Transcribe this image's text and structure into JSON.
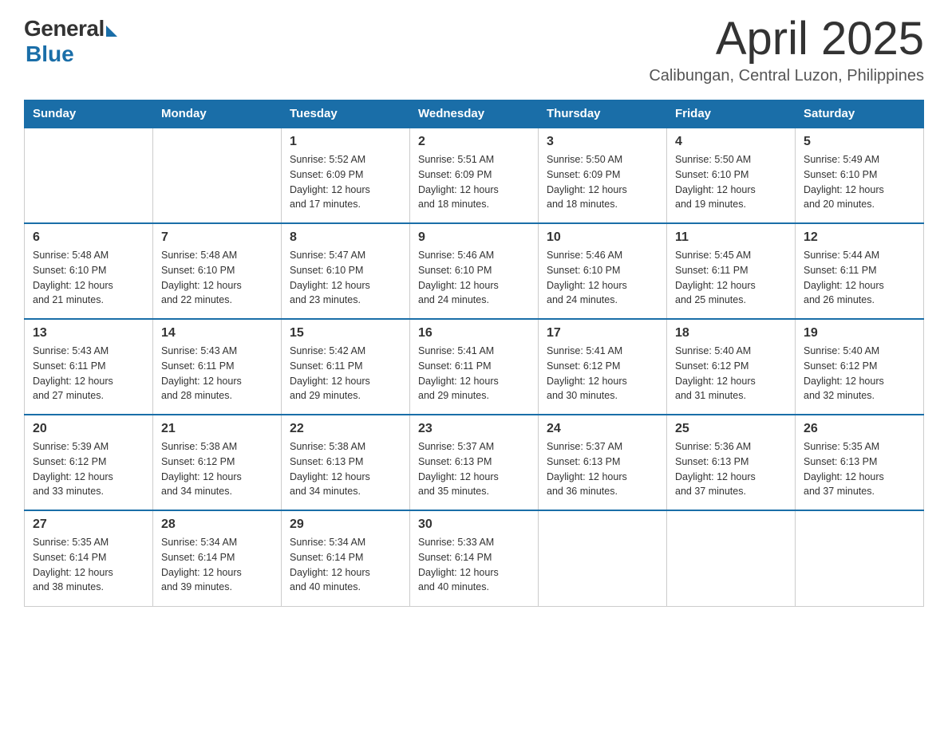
{
  "logo": {
    "general": "General",
    "blue": "Blue",
    "underline": "Blue"
  },
  "title": {
    "month_year": "April 2025",
    "location": "Calibungan, Central Luzon, Philippines"
  },
  "days_of_week": [
    "Sunday",
    "Monday",
    "Tuesday",
    "Wednesday",
    "Thursday",
    "Friday",
    "Saturday"
  ],
  "weeks": [
    [
      {
        "day": "",
        "info": ""
      },
      {
        "day": "",
        "info": ""
      },
      {
        "day": "1",
        "info": "Sunrise: 5:52 AM\nSunset: 6:09 PM\nDaylight: 12 hours\nand 17 minutes."
      },
      {
        "day": "2",
        "info": "Sunrise: 5:51 AM\nSunset: 6:09 PM\nDaylight: 12 hours\nand 18 minutes."
      },
      {
        "day": "3",
        "info": "Sunrise: 5:50 AM\nSunset: 6:09 PM\nDaylight: 12 hours\nand 18 minutes."
      },
      {
        "day": "4",
        "info": "Sunrise: 5:50 AM\nSunset: 6:10 PM\nDaylight: 12 hours\nand 19 minutes."
      },
      {
        "day": "5",
        "info": "Sunrise: 5:49 AM\nSunset: 6:10 PM\nDaylight: 12 hours\nand 20 minutes."
      }
    ],
    [
      {
        "day": "6",
        "info": "Sunrise: 5:48 AM\nSunset: 6:10 PM\nDaylight: 12 hours\nand 21 minutes."
      },
      {
        "day": "7",
        "info": "Sunrise: 5:48 AM\nSunset: 6:10 PM\nDaylight: 12 hours\nand 22 minutes."
      },
      {
        "day": "8",
        "info": "Sunrise: 5:47 AM\nSunset: 6:10 PM\nDaylight: 12 hours\nand 23 minutes."
      },
      {
        "day": "9",
        "info": "Sunrise: 5:46 AM\nSunset: 6:10 PM\nDaylight: 12 hours\nand 24 minutes."
      },
      {
        "day": "10",
        "info": "Sunrise: 5:46 AM\nSunset: 6:10 PM\nDaylight: 12 hours\nand 24 minutes."
      },
      {
        "day": "11",
        "info": "Sunrise: 5:45 AM\nSunset: 6:11 PM\nDaylight: 12 hours\nand 25 minutes."
      },
      {
        "day": "12",
        "info": "Sunrise: 5:44 AM\nSunset: 6:11 PM\nDaylight: 12 hours\nand 26 minutes."
      }
    ],
    [
      {
        "day": "13",
        "info": "Sunrise: 5:43 AM\nSunset: 6:11 PM\nDaylight: 12 hours\nand 27 minutes."
      },
      {
        "day": "14",
        "info": "Sunrise: 5:43 AM\nSunset: 6:11 PM\nDaylight: 12 hours\nand 28 minutes."
      },
      {
        "day": "15",
        "info": "Sunrise: 5:42 AM\nSunset: 6:11 PM\nDaylight: 12 hours\nand 29 minutes."
      },
      {
        "day": "16",
        "info": "Sunrise: 5:41 AM\nSunset: 6:11 PM\nDaylight: 12 hours\nand 29 minutes."
      },
      {
        "day": "17",
        "info": "Sunrise: 5:41 AM\nSunset: 6:12 PM\nDaylight: 12 hours\nand 30 minutes."
      },
      {
        "day": "18",
        "info": "Sunrise: 5:40 AM\nSunset: 6:12 PM\nDaylight: 12 hours\nand 31 minutes."
      },
      {
        "day": "19",
        "info": "Sunrise: 5:40 AM\nSunset: 6:12 PM\nDaylight: 12 hours\nand 32 minutes."
      }
    ],
    [
      {
        "day": "20",
        "info": "Sunrise: 5:39 AM\nSunset: 6:12 PM\nDaylight: 12 hours\nand 33 minutes."
      },
      {
        "day": "21",
        "info": "Sunrise: 5:38 AM\nSunset: 6:12 PM\nDaylight: 12 hours\nand 34 minutes."
      },
      {
        "day": "22",
        "info": "Sunrise: 5:38 AM\nSunset: 6:13 PM\nDaylight: 12 hours\nand 34 minutes."
      },
      {
        "day": "23",
        "info": "Sunrise: 5:37 AM\nSunset: 6:13 PM\nDaylight: 12 hours\nand 35 minutes."
      },
      {
        "day": "24",
        "info": "Sunrise: 5:37 AM\nSunset: 6:13 PM\nDaylight: 12 hours\nand 36 minutes."
      },
      {
        "day": "25",
        "info": "Sunrise: 5:36 AM\nSunset: 6:13 PM\nDaylight: 12 hours\nand 37 minutes."
      },
      {
        "day": "26",
        "info": "Sunrise: 5:35 AM\nSunset: 6:13 PM\nDaylight: 12 hours\nand 37 minutes."
      }
    ],
    [
      {
        "day": "27",
        "info": "Sunrise: 5:35 AM\nSunset: 6:14 PM\nDaylight: 12 hours\nand 38 minutes."
      },
      {
        "day": "28",
        "info": "Sunrise: 5:34 AM\nSunset: 6:14 PM\nDaylight: 12 hours\nand 39 minutes."
      },
      {
        "day": "29",
        "info": "Sunrise: 5:34 AM\nSunset: 6:14 PM\nDaylight: 12 hours\nand 40 minutes."
      },
      {
        "day": "30",
        "info": "Sunrise: 5:33 AM\nSunset: 6:14 PM\nDaylight: 12 hours\nand 40 minutes."
      },
      {
        "day": "",
        "info": ""
      },
      {
        "day": "",
        "info": ""
      },
      {
        "day": "",
        "info": ""
      }
    ]
  ]
}
